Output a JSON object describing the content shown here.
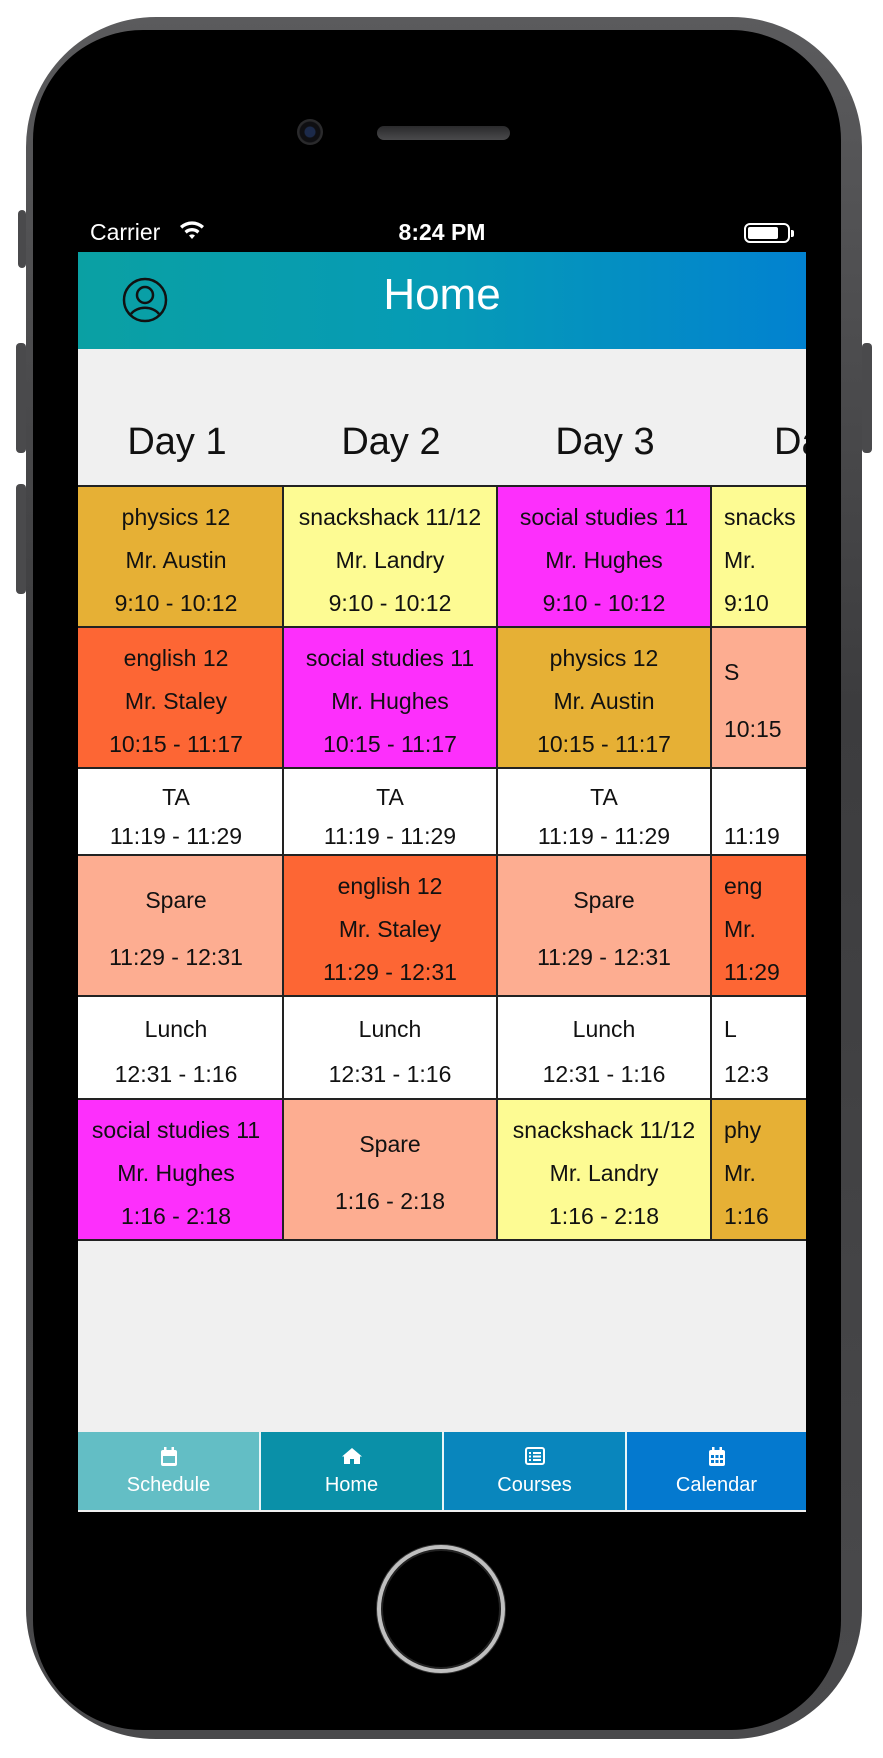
{
  "status_bar": {
    "carrier": "Carrier",
    "time": "8:24 PM"
  },
  "header": {
    "title": "Home"
  },
  "days": [
    "Day 1",
    "Day 2",
    "Day 3",
    "Da"
  ],
  "schedule": [
    [
      {
        "l1": "physics 12",
        "l2": "Mr. Austin",
        "l3": "9:10 - 10:12",
        "color": "#e6b035"
      },
      {
        "l1": "snackshack 11/12",
        "l2": "Mr. Landry",
        "l3": "9:10 - 10:12",
        "color": "#fdfb93"
      },
      {
        "l1": "social studies 11",
        "l2": "Mr. Hughes",
        "l3": "9:10 - 10:12",
        "color": "#fd2ffc"
      },
      {
        "l1": "snacks",
        "l2": "Mr.",
        "l3": "9:10",
        "color": "#fdfb93"
      }
    ],
    [
      {
        "l1": "english 12",
        "l2": "Mr. Staley",
        "l3": "10:15 - 11:17",
        "color": "#fd6634"
      },
      {
        "l1": "social studies 11",
        "l2": "Mr. Hughes",
        "l3": "10:15 - 11:17",
        "color": "#fd2ffc"
      },
      {
        "l1": "physics 12",
        "l2": "Mr. Austin",
        "l3": "10:15 - 11:17",
        "color": "#e6b035"
      },
      {
        "l1": "S",
        "l2": "",
        "l3": "10:15",
        "color": "#fdad91"
      }
    ],
    [
      {
        "l1": "TA",
        "l3": "11:19 - 11:29",
        "color": "#ffffff"
      },
      {
        "l1": "TA",
        "l3": "11:19 - 11:29",
        "color": "#ffffff"
      },
      {
        "l1": "TA",
        "l3": "11:19 - 11:29",
        "color": "#ffffff"
      },
      {
        "l1": "",
        "l3": "11:19",
        "color": "#ffffff"
      }
    ],
    [
      {
        "l1": "Spare",
        "l2": "",
        "l3": "11:29 - 12:31",
        "color": "#fdad91"
      },
      {
        "l1": "english 12",
        "l2": "Mr. Staley",
        "l3": "11:29 - 12:31",
        "color": "#fd6634"
      },
      {
        "l1": "Spare",
        "l2": "",
        "l3": "11:29 - 12:31",
        "color": "#fdad91"
      },
      {
        "l1": "eng",
        "l2": "Mr.",
        "l3": "11:29",
        "color": "#fd6634"
      }
    ],
    [
      {
        "l1": "Lunch",
        "l3": "12:31 - 1:16",
        "color": "#ffffff"
      },
      {
        "l1": "Lunch",
        "l3": "12:31 - 1:16",
        "color": "#ffffff"
      },
      {
        "l1": "Lunch",
        "l3": "12:31 - 1:16",
        "color": "#ffffff"
      },
      {
        "l1": "L",
        "l3": "12:3",
        "color": "#ffffff"
      }
    ],
    [
      {
        "l1": "social studies 11",
        "l2": "Mr. Hughes",
        "l3": "1:16 - 2:18",
        "color": "#fd2ffc"
      },
      {
        "l1": "Spare",
        "l2": "",
        "l3": "1:16 - 2:18",
        "color": "#fdad91"
      },
      {
        "l1": "snackshack 11/12",
        "l2": "Mr. Landry",
        "l3": "1:16 - 2:18",
        "color": "#fdfb93"
      },
      {
        "l1": "phy",
        "l2": "Mr.",
        "l3": "1:16",
        "color": "#e6b035"
      }
    ]
  ],
  "tabs": [
    {
      "label": "Schedule",
      "icon": "calendar-day-icon",
      "active": true
    },
    {
      "label": "Home",
      "icon": "home-icon",
      "active": false
    },
    {
      "label": "Courses",
      "icon": "list-icon",
      "active": false
    },
    {
      "label": "Calendar",
      "icon": "calendar-grid-icon",
      "active": false
    }
  ],
  "colors": {
    "header_start": "#0aa0a3",
    "header_end": "#0282d0",
    "tab_active": "#63bec5",
    "tab_2": "#0a90a8",
    "tab_3": "#0986bd",
    "tab_4": "#0479cf"
  }
}
